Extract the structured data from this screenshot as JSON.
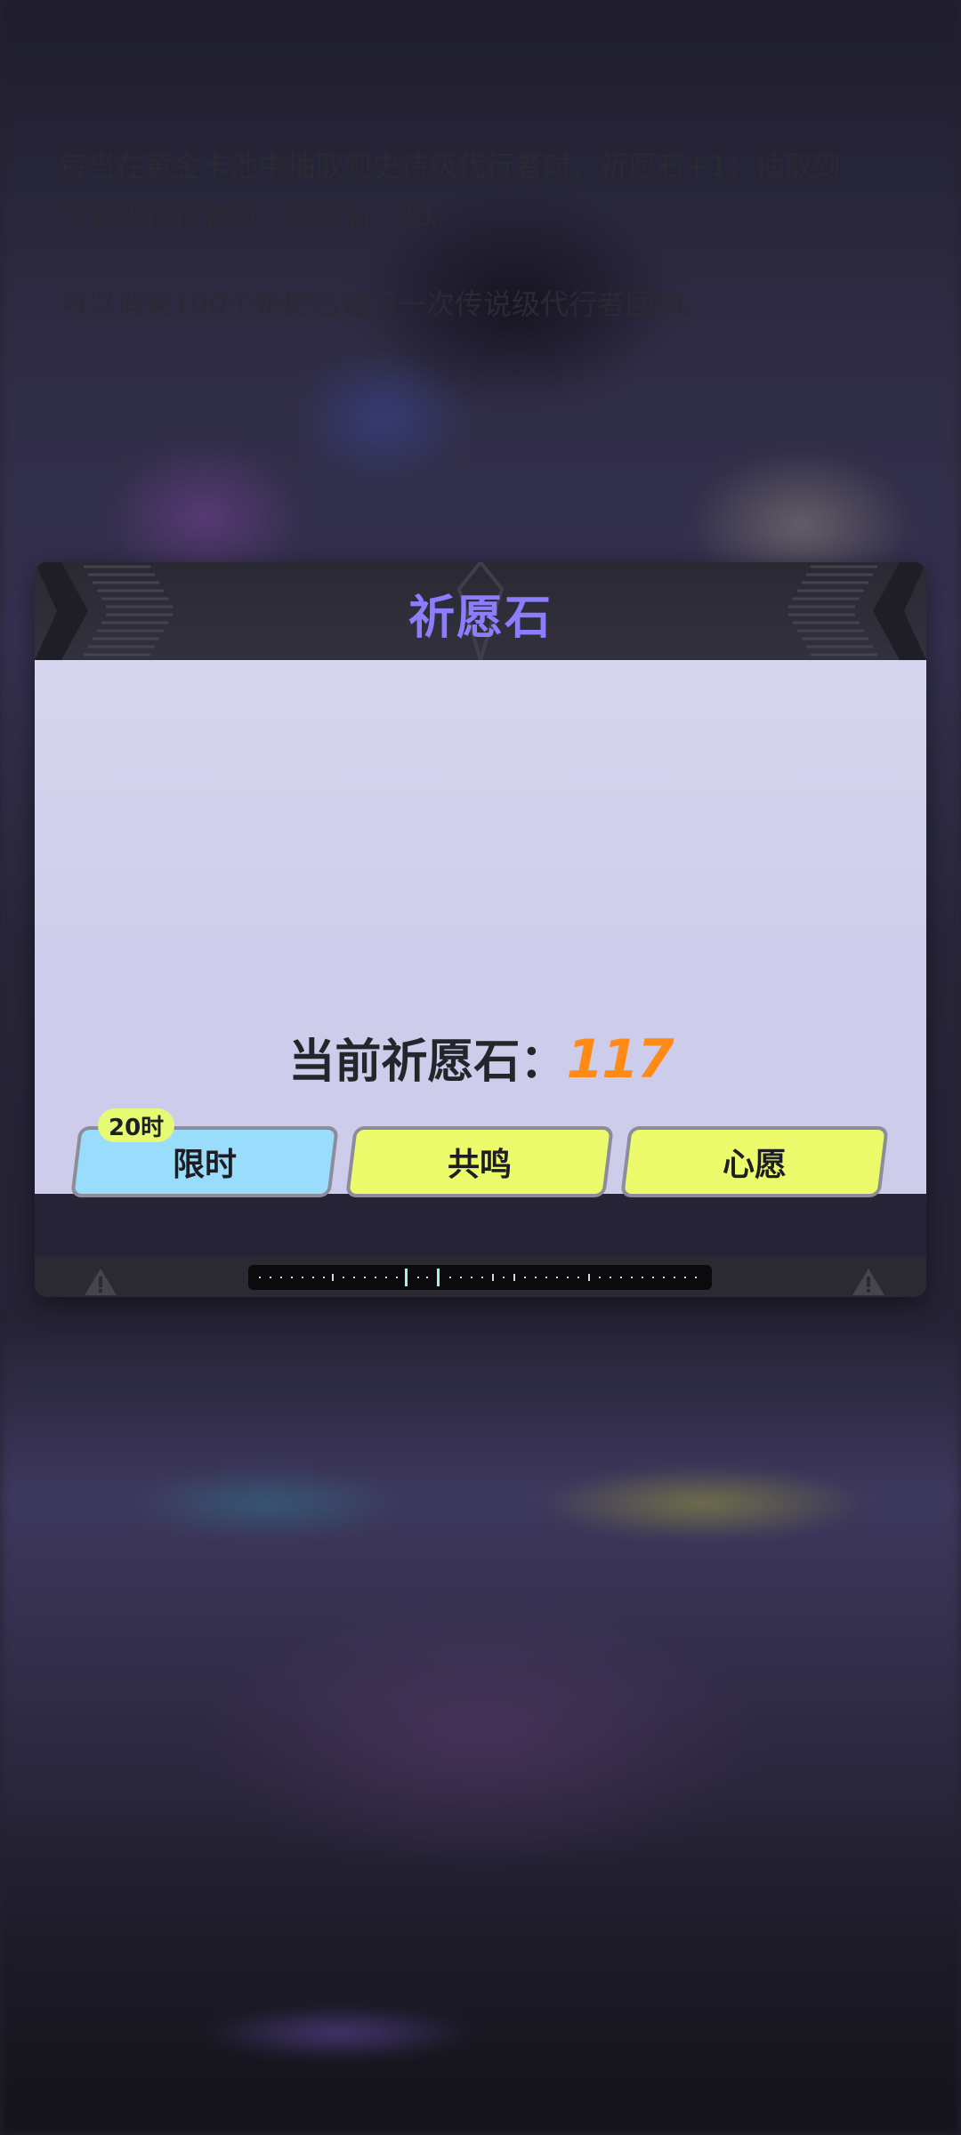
{
  "dialog": {
    "title": "祈愿石",
    "description_line1": "每当在黄金卡池中抽取到史诗级代行者时，祈愿石+1；抽取到传说级代行者时，祈愿石+20。",
    "description_line2": "可以消耗100个祈愿石进行一次传说级代行者回响。",
    "current_label": "当前祈愿石：",
    "current_value": "117",
    "buttons": [
      {
        "label": "限时",
        "badge": "20时",
        "color": "#9adcfb"
      },
      {
        "label": "共鸣",
        "color": "#ecfb6b"
      },
      {
        "label": "心愿",
        "color": "#ecfb6b"
      }
    ]
  },
  "colors": {
    "title": "#8c7dff",
    "value": "#ff8a16",
    "body_bg": "#d2d2ec",
    "header_bg": "#2a2933"
  },
  "icons": [
    "warning-icon",
    "chevron-decor"
  ]
}
